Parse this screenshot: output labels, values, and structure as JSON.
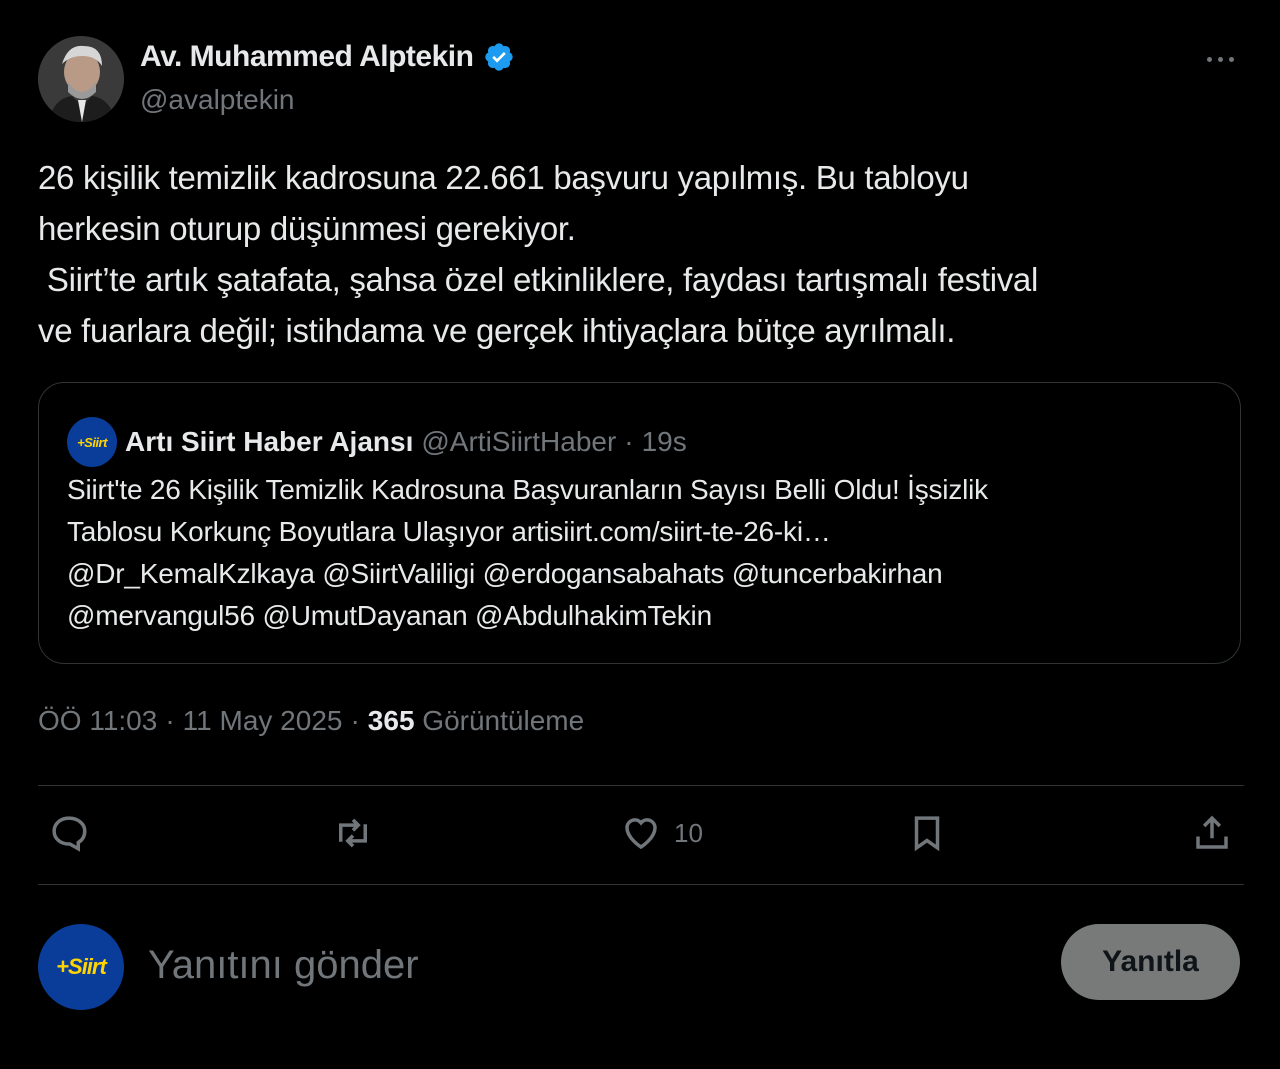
{
  "author": {
    "name": "Av. Muhammed Alptekin",
    "handle": "@avalptekin",
    "verified": true
  },
  "tweet": {
    "lines": [
      "26 kişilik temizlik kadrosuna 22.661 başvuru yapılmış. Bu tabloyu",
      "herkesin oturup düşünmesi gerekiyor.",
      " Siirt’te artık şatafata, şahsa özel etkinliklere, faydası tartışmalı festival",
      "ve fuarlara değil; istihdama ve gerçek ihtiyaçlara bütçe ayrılmalı."
    ]
  },
  "quote": {
    "logo_text": "+Siirt",
    "name": "Artı Siirt Haber Ajansı",
    "handle": "@ArtiSiirtHaber",
    "separator": "·",
    "time": "19s",
    "lines": [
      "Siirt'te 26 Kişilik Temizlik Kadrosuna Başvuranların Sayısı Belli Oldu! İşsizlik",
      "Tablosu Korkunç Boyutlara Ulaşıyor artisiirt.com/siirt-te-26-ki…",
      "@Dr_KemalKzlkaya @SiirtValiligi @erdogansabahats @tuncerbakirhan",
      "@mervangul56 @UmutDayanan @AbdulhakimTekin"
    ]
  },
  "meta": {
    "time": "ÖÖ 11:03",
    "separator": "·",
    "date": "11 May 2025",
    "views_count": "365",
    "views_label": "Görüntüleme"
  },
  "actions": {
    "reply_icon": "comment-icon",
    "retweet_icon": "retweet-icon",
    "like_icon": "heart-icon",
    "like_count": "10",
    "bookmark_icon": "bookmark-icon",
    "share_icon": "share-icon"
  },
  "reply_box": {
    "avatar_text": "+Siirt",
    "placeholder": "Yanıtını gönder",
    "button_label": "Yanıtla"
  },
  "colors": {
    "background": "#000000",
    "text": "#e7e9ea",
    "secondary": "#71767b",
    "border": "#2f3336",
    "verified": "#1d9bf0",
    "button_disabled": "#787a7a"
  }
}
